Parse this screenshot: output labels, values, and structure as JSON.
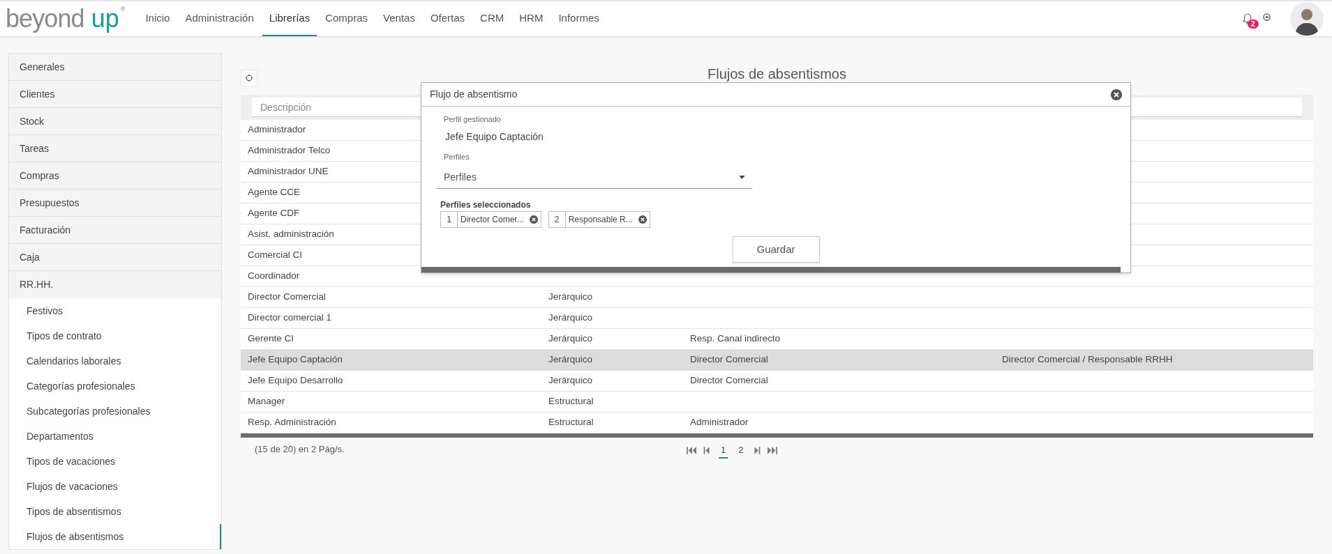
{
  "logo": {
    "word1": "beyond",
    "word2": "up",
    "mark": "®"
  },
  "nav": [
    {
      "label": "Inicio",
      "selected": false
    },
    {
      "label": "Administración",
      "selected": false
    },
    {
      "label": "Librerías",
      "selected": true
    },
    {
      "label": "Compras",
      "selected": false
    },
    {
      "label": "Ventas",
      "selected": false
    },
    {
      "label": "Ofertas",
      "selected": false
    },
    {
      "label": "CRM",
      "selected": false
    },
    {
      "label": "HRM",
      "selected": false
    },
    {
      "label": "Informes",
      "selected": false
    }
  ],
  "notifications": {
    "count": "2"
  },
  "sidebar": {
    "items": [
      {
        "label": "Generales",
        "expanded": false
      },
      {
        "label": "Clientes",
        "expanded": false
      },
      {
        "label": "Stock",
        "expanded": false
      },
      {
        "label": "Tareas",
        "expanded": false
      },
      {
        "label": "Compras",
        "expanded": false
      },
      {
        "label": "Presupuestos",
        "expanded": false
      },
      {
        "label": "Facturación",
        "expanded": false
      },
      {
        "label": "Caja",
        "expanded": false
      },
      {
        "label": "RR.HH.",
        "expanded": true,
        "children": [
          {
            "label": "Festivos",
            "selected": false
          },
          {
            "label": "Tipos de contrato",
            "selected": false
          },
          {
            "label": "Calendarios laborales",
            "selected": false
          },
          {
            "label": "Categorías profesionales",
            "selected": false
          },
          {
            "label": "Subcategorías profesionales",
            "selected": false
          },
          {
            "label": "Departamentos",
            "selected": false
          },
          {
            "label": "Tipos de vacaciones",
            "selected": false
          },
          {
            "label": "Flujos de vacaciones",
            "selected": false
          },
          {
            "label": "Tipos de absentismos",
            "selected": false
          },
          {
            "label": "Flujos de absentismos",
            "selected": true
          }
        ]
      }
    ]
  },
  "page_title": "Flujos de absentismos",
  "filter": {
    "placeholder": "Descripción"
  },
  "table": {
    "rows": [
      {
        "cells": [
          "Administrador"
        ],
        "selected": false
      },
      {
        "cells": [
          "Administrador Telco"
        ],
        "selected": false
      },
      {
        "cells": [
          "Administrador UNE"
        ],
        "selected": false
      },
      {
        "cells": [
          "Agente CCE"
        ],
        "selected": false
      },
      {
        "cells": [
          "Agente CDF"
        ],
        "selected": false
      },
      {
        "cells": [
          "Asist. administración"
        ],
        "selected": false
      },
      {
        "cells": [
          "Comercial CI"
        ],
        "selected": false
      },
      {
        "cells": [
          "Coordinador"
        ],
        "selected": false
      },
      {
        "cells": [
          "Director Comercial",
          "Jerárquico"
        ],
        "selected": false
      },
      {
        "cells": [
          "Director comercial 1",
          "Jerárquico"
        ],
        "selected": false
      },
      {
        "cells": [
          "Gerente CI",
          "Jerárquico",
          "Resp. Canal indirecto"
        ],
        "selected": false
      },
      {
        "cells": [
          "Jefe Equipo Captación",
          "Jerárquico",
          "Director Comercial",
          "Director Comercial / Responsable RRHH"
        ],
        "selected": true
      },
      {
        "cells": [
          "Jefe Equipo Desarrollo",
          "Jerárquico",
          "Director Comercial"
        ],
        "selected": false
      },
      {
        "cells": [
          "Manager",
          "Estructural"
        ],
        "selected": false
      },
      {
        "cells": [
          "Resp. Administración",
          "Estructural",
          "Administrador"
        ],
        "selected": false
      }
    ]
  },
  "pagination": {
    "summary": "(15 de 20) en 2 Pág/s.",
    "pages": [
      {
        "label": "1",
        "selected": true
      },
      {
        "label": "2",
        "selected": false
      }
    ]
  },
  "dialog": {
    "title": "Flujo de absentismo",
    "managed_label": "Perfil gestionado",
    "managed_value": "Jefe Equipo Captación",
    "profiles_label": "Perfiles",
    "profiles_select": "Perfiles",
    "selected_label": "Perfiles seleccionados",
    "chips": [
      {
        "index": "1",
        "label": "Director Comer..."
      },
      {
        "index": "2",
        "label": "Responsable R..."
      }
    ],
    "save": "Guardar"
  }
}
